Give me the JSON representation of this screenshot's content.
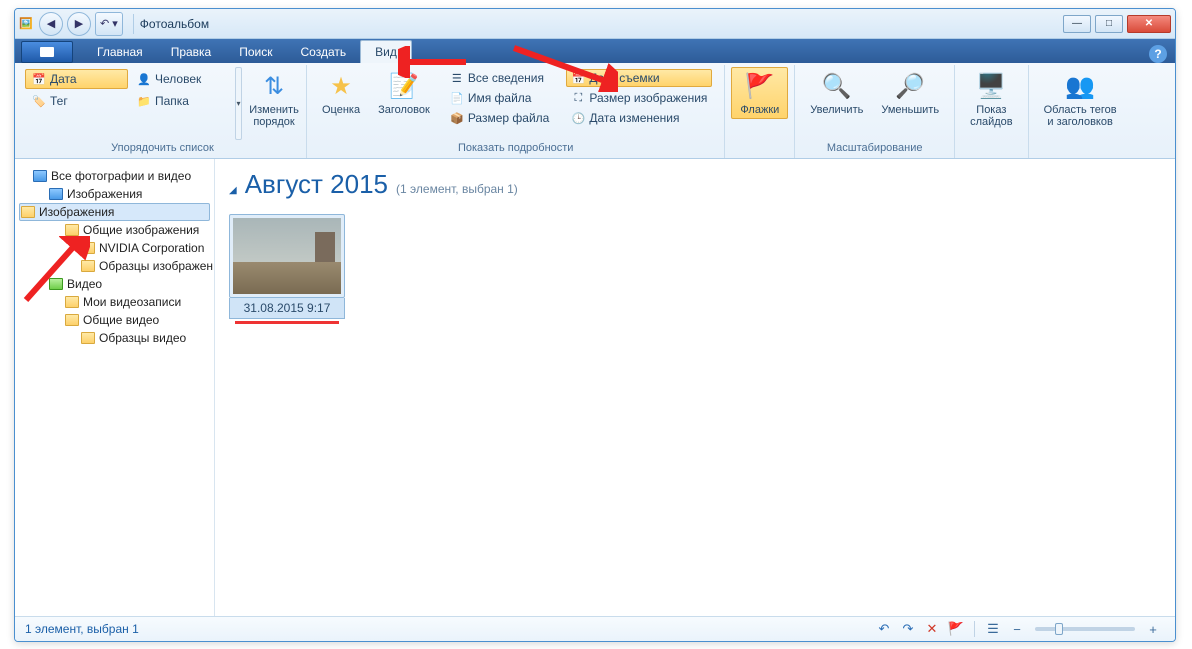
{
  "window": {
    "title": "Фотоальбом"
  },
  "tabs": {
    "main": "Главная",
    "edit": "Правка",
    "search": "Поиск",
    "create": "Создать",
    "view": "Вид"
  },
  "ribbon": {
    "sort": {
      "group_label": "Упорядочить список",
      "date": "Дата",
      "tag": "Тег",
      "person": "Человек",
      "folder": "Папка",
      "reorder": "Изменить\nпорядок"
    },
    "details": {
      "group_label": "Показать подробности",
      "rating": "Оценка",
      "caption": "Заголовок",
      "all": "Все сведения",
      "filename": "Имя файла",
      "filesize": "Размер файла",
      "date_taken": "Дата съемки",
      "image_size": "Размер изображения",
      "date_modified": "Дата изменения"
    },
    "flags": {
      "label": "Флажки"
    },
    "zoom": {
      "group_label": "Масштабирование",
      "in": "Увеличить",
      "out": "Уменьшить"
    },
    "slideshow": {
      "label": "Показ\nслайдов"
    },
    "tagarea": {
      "label": "Область тегов\nи заголовков"
    }
  },
  "tree": {
    "all": "Все фотографии и видео",
    "pictures": "Изображения",
    "pictures2": "Изображения",
    "shared_pics": "Общие изображения",
    "nvidia": "NVIDIA Corporation",
    "sample_pics": "Образцы изображен",
    "video": "Видео",
    "my_videos": "Мои видеозаписи",
    "shared_videos": "Общие видео",
    "sample_videos": "Образцы видео"
  },
  "main": {
    "group_title": "Август 2015",
    "group_sub": "(1 элемент, выбран 1)",
    "thumb_caption": "31.08.2015 9:17"
  },
  "status": {
    "text": "1 элемент, выбран 1"
  }
}
